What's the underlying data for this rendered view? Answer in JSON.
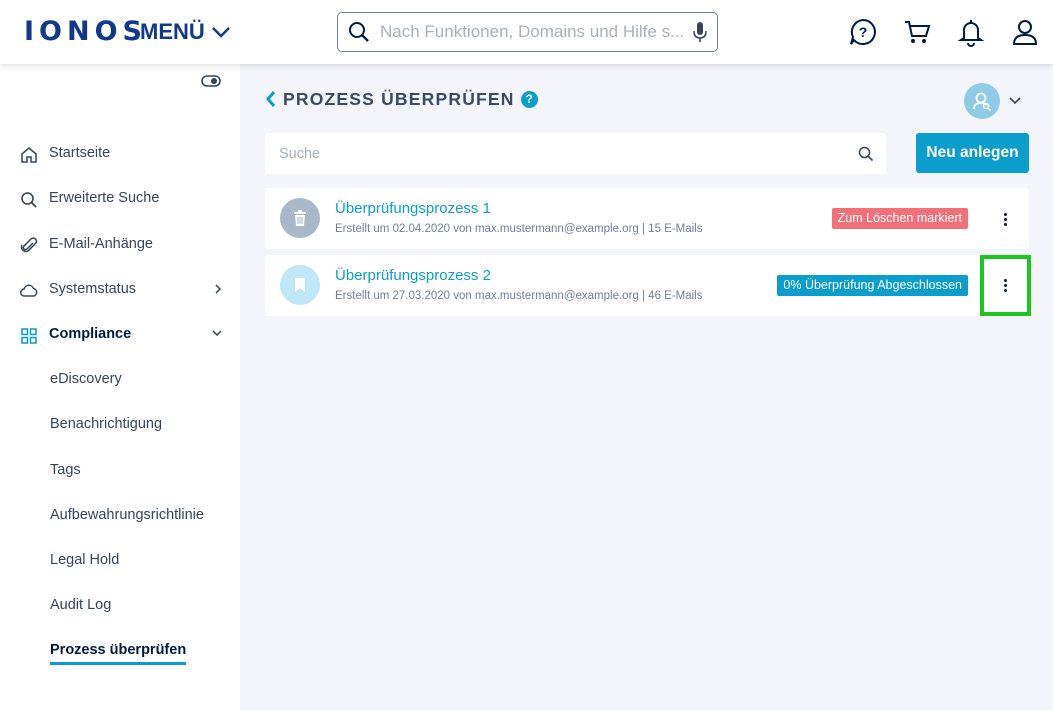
{
  "header": {
    "logo": "IONOS",
    "menu_label": "MENÜ",
    "search_placeholder": "Nach Funktionen, Domains und Hilfe s...",
    "icons": [
      "help-chat-icon",
      "cart-icon",
      "bell-icon",
      "user-icon"
    ]
  },
  "sidebar": {
    "items": [
      {
        "label": "Startseite",
        "icon": "home-icon"
      },
      {
        "label": "Erweiterte Suche",
        "icon": "search-icon"
      },
      {
        "label": "E-Mail-Anhänge",
        "icon": "paperclip-icon"
      },
      {
        "label": "Systemstatus",
        "icon": "cloud-icon"
      },
      {
        "label": "Compliance",
        "icon": "grid-icon"
      }
    ],
    "compliance_subitems": [
      {
        "label": "eDiscovery"
      },
      {
        "label": "Benachrichtigung"
      },
      {
        "label": "Tags"
      },
      {
        "label": "Aufbewahrungsrichtlinie"
      },
      {
        "label": "Legal Hold"
      },
      {
        "label": "Audit Log"
      },
      {
        "label": "Prozess überprüfen"
      }
    ]
  },
  "main": {
    "title": "PROZESS ÜBERPRÜFEN",
    "help_glyph": "?",
    "search_placeholder": "Suche",
    "new_button": "Neu anlegen",
    "processes": [
      {
        "title": "Überprüfungsprozess 1",
        "subtitle": "Erstellt um 02.04.2020 von max.mustermann@example.org | 15 E-Mails",
        "badge": "Zum Löschen markiert",
        "badge_color": "#f2707a",
        "icon": "trash-icon",
        "icon_bg": "#a9b8c9"
      },
      {
        "title": "Überprüfungsprozess 2",
        "subtitle": "Erstellt um 27.03.2020 von max.mustermann@example.org | 46 E-Mails",
        "badge": "0% Überprüfung Abgeschlossen",
        "badge_color": "#0b9dcc",
        "icon": "bookmark-icon",
        "icon_bg": "#bfe7f7"
      }
    ]
  },
  "colors": {
    "brand": "#11388a",
    "accent": "#0b9dcc",
    "highlight": "#1cc620"
  }
}
